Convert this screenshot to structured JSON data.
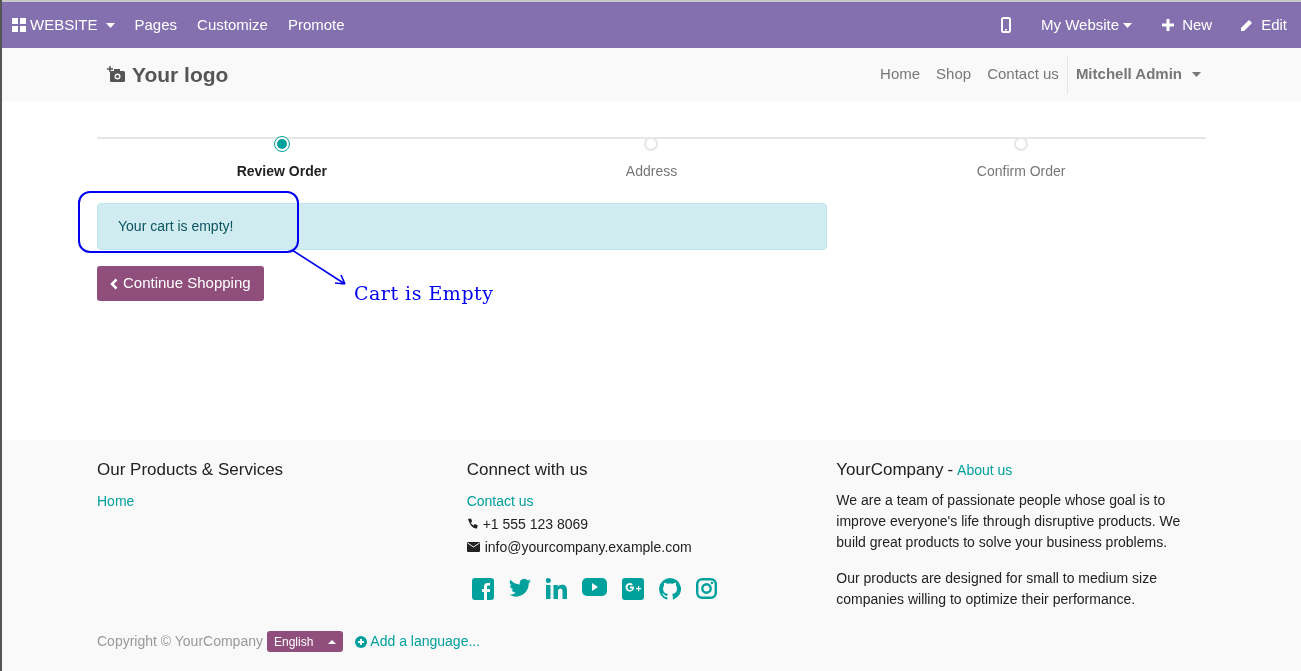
{
  "admin_bar": {
    "app": "WEBSITE",
    "menu": [
      "Pages",
      "Customize",
      "Promote"
    ],
    "website": "My Website",
    "new": "New",
    "edit": "Edit"
  },
  "header": {
    "logo": "Your logo",
    "nav": [
      "Home",
      "Shop",
      "Contact us"
    ],
    "user": "Mitchell Admin"
  },
  "steps": [
    {
      "label": "Review Order",
      "selected": true
    },
    {
      "label": "Address",
      "selected": false
    },
    {
      "label": "Confirm Order",
      "selected": false
    }
  ],
  "alert": "Your cart is empty!",
  "continue_button": "Continue Shopping",
  "annotation": "Cart is Empty",
  "footer": {
    "col1": {
      "title": "Our Products & Services",
      "links": [
        "Home"
      ]
    },
    "col2": {
      "title": "Connect with us",
      "link": "Contact us",
      "phone": "+1 555 123 8069",
      "email": "info@yourcompany.example.com"
    },
    "col3": {
      "title": "YourCompany",
      "separator": "-",
      "link": "About us",
      "paragraphs": [
        "We are a team of passionate people whose goal is to improve everyone's life through disruptive products. We build great products to solve your business problems.",
        "Our products are designed for small to medium size companies willing to optimize their performance."
      ]
    },
    "copyright": "Copyright © YourCompany",
    "language": "English",
    "add_language": "Add a language..."
  }
}
